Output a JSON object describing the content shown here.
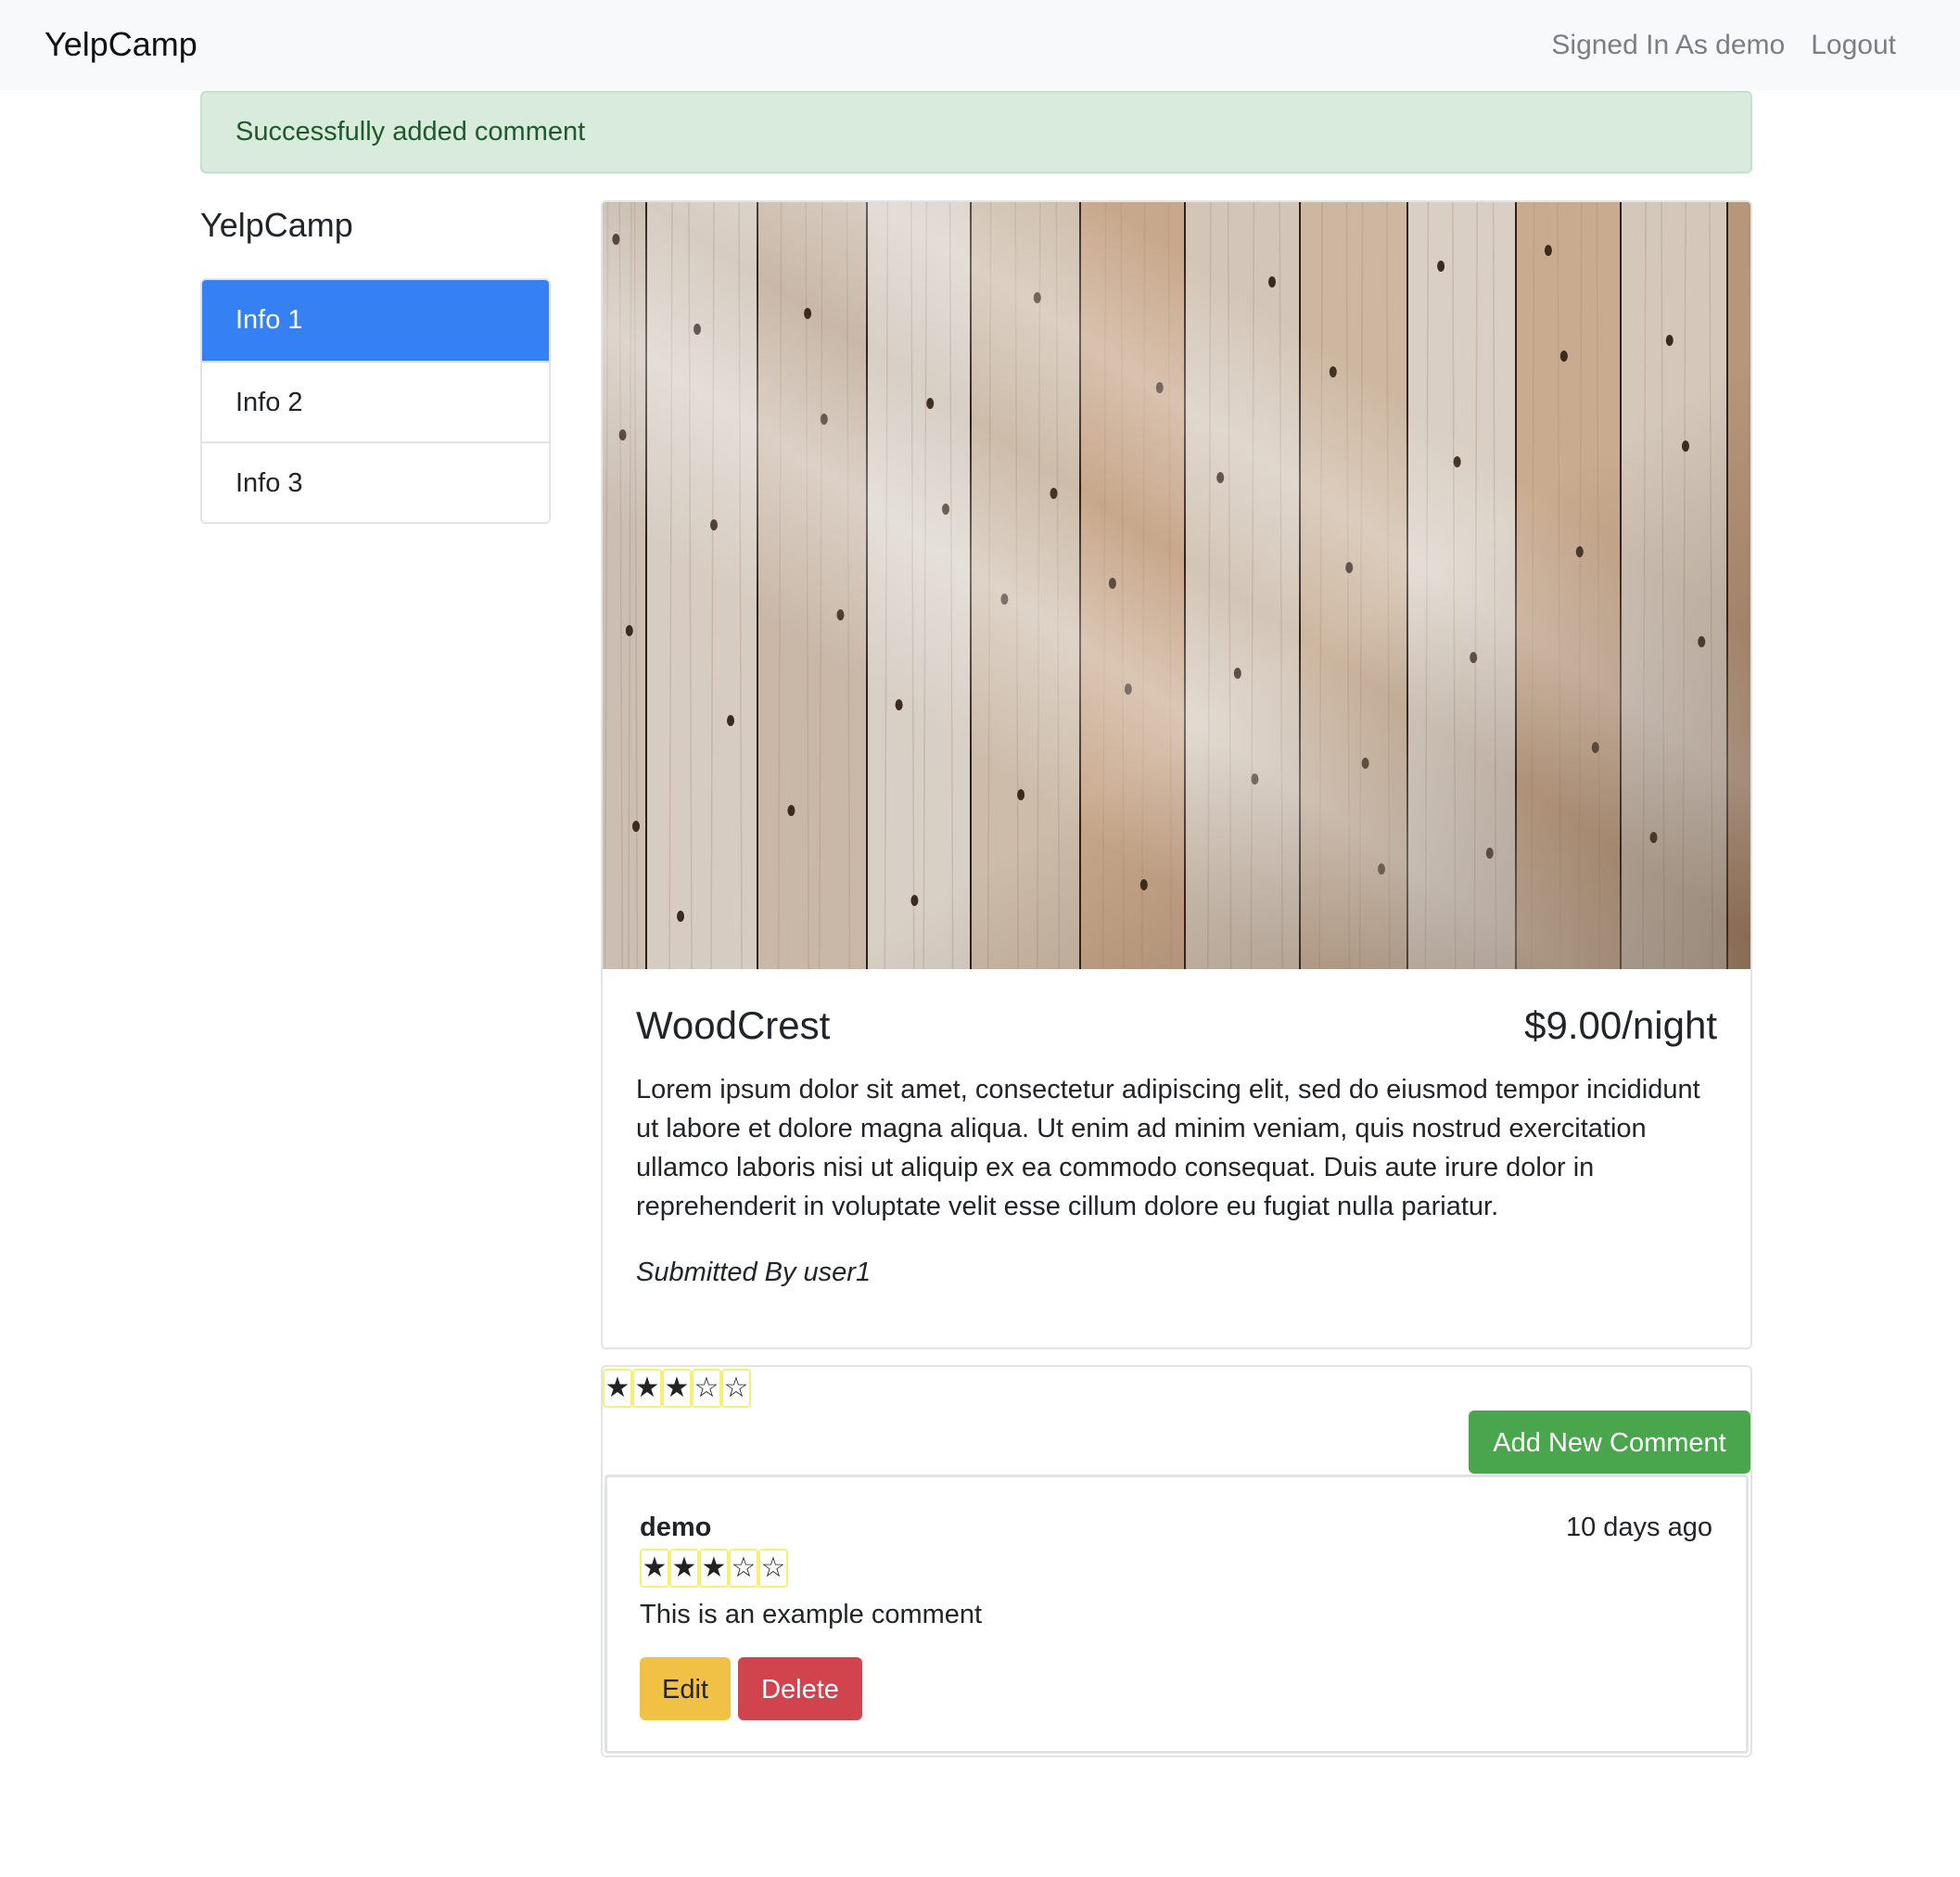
{
  "navbar": {
    "brand": "YelpCamp",
    "signed_in": "Signed In As demo",
    "logout": "Logout"
  },
  "alert": {
    "message": "Successfully added comment"
  },
  "sidebar": {
    "title": "YelpCamp",
    "items": [
      {
        "label": "Info 1",
        "active": true
      },
      {
        "label": "Info 2",
        "active": false
      },
      {
        "label": "Info 3",
        "active": false
      }
    ]
  },
  "campground": {
    "name": "WoodCrest",
    "price": "$9.00/night",
    "description": "Lorem ipsum dolor sit amet, consectetur adipiscing elit, sed do eiusmod tempor incididunt ut labore et dolore magna aliqua. Ut enim ad minim veniam, quis nostrud exercitation ullamco laboris nisi ut aliquip ex ea commodo consequat. Duis aute irure dolor in reprehenderit in voluptate velit esse cillum dolore eu fugiat nulla pariatur.",
    "submitted_by": "Submitted By user1",
    "image_icon": "wood-planks-photo"
  },
  "comments_section": {
    "average_rating": 3,
    "max_rating": 5,
    "add_button": "Add New Comment",
    "comments": [
      {
        "author": "demo",
        "time": "10 days ago",
        "rating": 3,
        "text": "This is an example comment",
        "edit_label": "Edit",
        "delete_label": "Delete"
      }
    ]
  },
  "colors": {
    "primary": "#3580f2",
    "success": "#4aa64c",
    "warning": "#f1c146",
    "danger": "#d1434d",
    "alert_bg": "#d9ebdc",
    "star_border": "#f5f074"
  }
}
